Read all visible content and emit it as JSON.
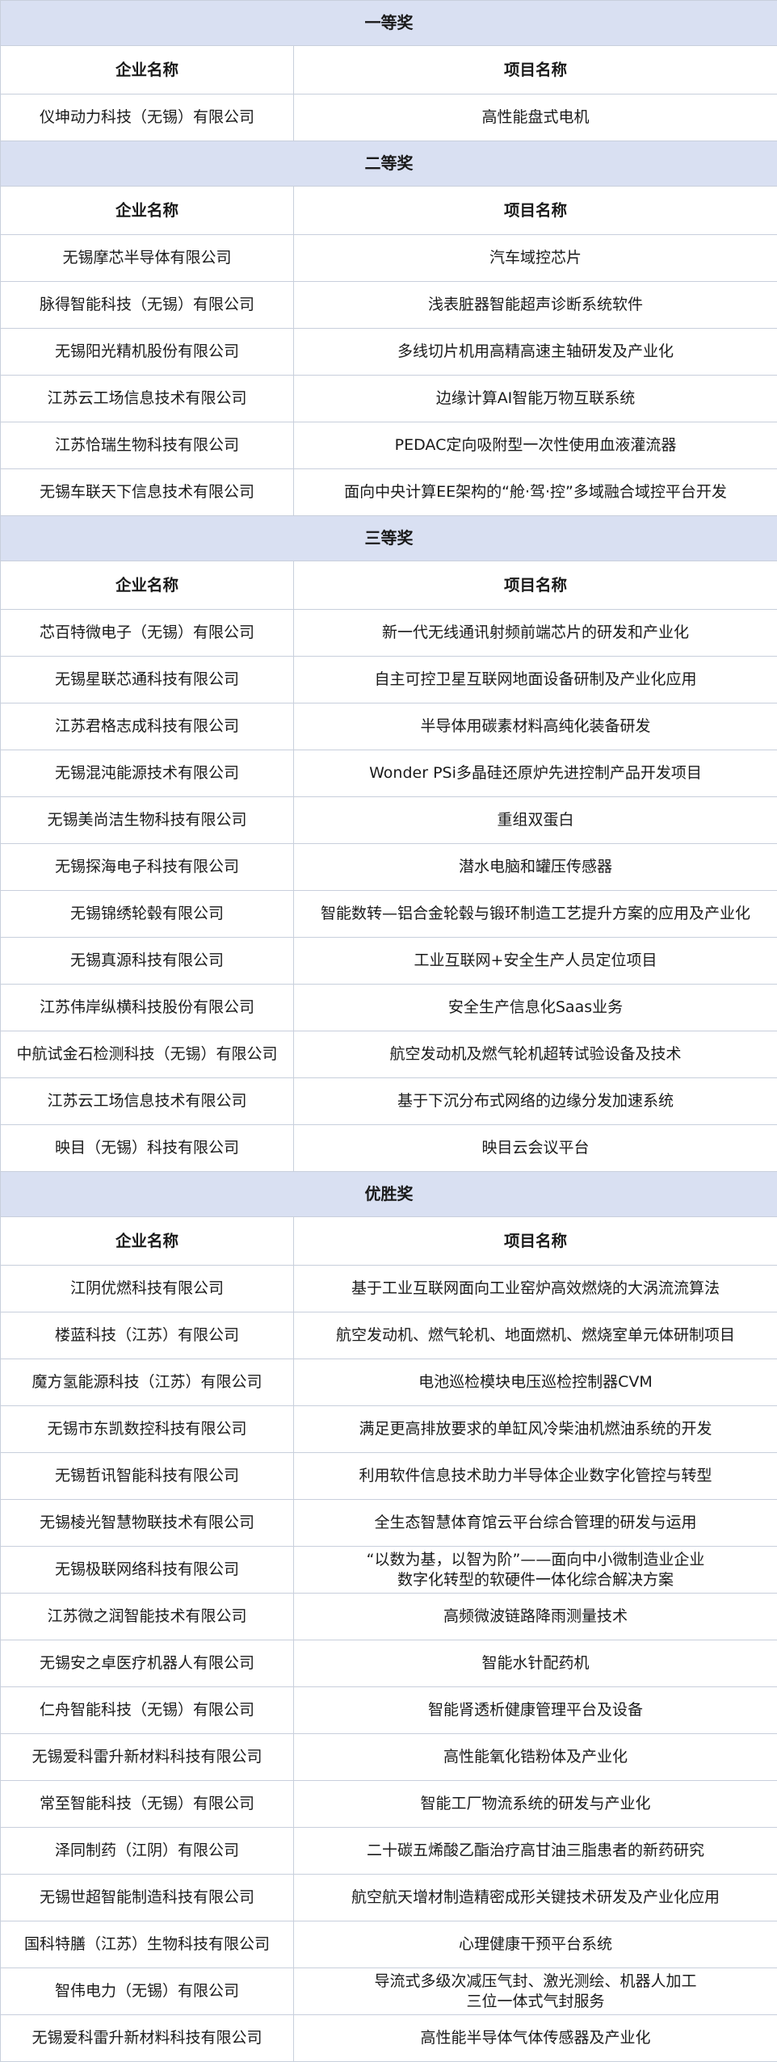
{
  "columns": {
    "company": "企业名称",
    "project": "项目名称"
  },
  "sections": [
    {
      "title": "一等奖",
      "rows": [
        {
          "company": "仪坤动力科技（无锡）有限公司",
          "project": "高性能盘式电机"
        }
      ]
    },
    {
      "title": "二等奖",
      "rows": [
        {
          "company": "无锡摩芯半导体有限公司",
          "project": "汽车域控芯片"
        },
        {
          "company": "脉得智能科技（无锡）有限公司",
          "project": "浅表脏器智能超声诊断系统软件"
        },
        {
          "company": "无锡阳光精机股份有限公司",
          "project": "多线切片机用高精高速主轴研发及产业化"
        },
        {
          "company": "江苏云工场信息技术有限公司",
          "project": "边缘计算AI智能万物互联系统"
        },
        {
          "company": "江苏恰瑞生物科技有限公司",
          "project": "PEDAC定向吸附型一次性使用血液灌流器"
        },
        {
          "company": "无锡车联天下信息技术有限公司",
          "project": "面向中央计算EE架构的“舱·驾·控”多域融合域控平台开发"
        }
      ]
    },
    {
      "title": "三等奖",
      "rows": [
        {
          "company": "芯百特微电子（无锡）有限公司",
          "project": "新一代无线通讯射频前端芯片的研发和产业化"
        },
        {
          "company": "无锡星联芯通科技有限公司",
          "project": "自主可控卫星互联网地面设备研制及产业化应用"
        },
        {
          "company": "江苏君格志成科技有限公司",
          "project": "半导体用碳素材料高纯化装备研发"
        },
        {
          "company": "无锡混沌能源技术有限公司",
          "project": "Wonder PSi多晶硅还原炉先进控制产品开发项目"
        },
        {
          "company": "无锡美尚洁生物科技有限公司",
          "project": "重组双蛋白"
        },
        {
          "company": "无锡探海电子科技有限公司",
          "project": "潜水电脑和罐压传感器"
        },
        {
          "company": "无锡锦绣轮毂有限公司",
          "project": "智能数转—铝合金轮毂与锻环制造工艺提升方案的应用及产业化"
        },
        {
          "company": "无锡真源科技有限公司",
          "project": "工业互联网+安全生产人员定位项目"
        },
        {
          "company": "江苏伟岸纵横科技股份有限公司",
          "project": "安全生产信息化Saas业务"
        },
        {
          "company": "中航试金石检测科技（无锡）有限公司",
          "project": "航空发动机及燃气轮机超转试验设备及技术"
        },
        {
          "company": "江苏云工场信息技术有限公司",
          "project": "基于下沉分布式网络的边缘分发加速系统"
        },
        {
          "company": "映目（无锡）科技有限公司",
          "project": "映目云会议平台"
        }
      ]
    },
    {
      "title": "优胜奖",
      "rows": [
        {
          "company": "江阴优燃科技有限公司",
          "project": "基于工业互联网面向工业窑炉高效燃烧的大涡流流算法"
        },
        {
          "company": "楼蓝科技（江苏）有限公司",
          "project": "航空发动机、燃气轮机、地面燃机、燃烧室单元体研制项目"
        },
        {
          "company": "魔方氢能源科技（江苏）有限公司",
          "project": "电池巡检模块电压巡检控制器CVM"
        },
        {
          "company": "无锡市东凯数控科技有限公司",
          "project": "满足更高排放要求的单缸风冷柴油机燃油系统的开发"
        },
        {
          "company": "无锡哲讯智能科技有限公司",
          "project": "利用软件信息技术助力半导体企业数字化管控与转型"
        },
        {
          "company": "无锡棱光智慧物联技术有限公司",
          "project": "全生态智慧体育馆云平台综合管理的研发与运用"
        },
        {
          "company": "无锡极联网络科技有限公司",
          "project": "“以数为基，以智为阶”——面向中小微制造业企业\n数字化转型的软硬件一体化综合解决方案"
        },
        {
          "company": "江苏微之润智能技术有限公司",
          "project": "高频微波链路降雨测量技术"
        },
        {
          "company": "无锡安之卓医疗机器人有限公司",
          "project": "智能水针配药机"
        },
        {
          "company": "仁舟智能科技（无锡）有限公司",
          "project": "智能肾透析健康管理平台及设备"
        },
        {
          "company": "无锡爱科雷升新材料科技有限公司",
          "project": "高性能氧化锆粉体及产业化"
        },
        {
          "company": "常至智能科技（无锡）有限公司",
          "project": "智能工厂物流系统的研发与产业化"
        },
        {
          "company": "泽同制药（江阴）有限公司",
          "project": "二十碳五烯酸乙酯治疗高甘油三脂患者的新药研究"
        },
        {
          "company": "无锡世超智能制造科技有限公司",
          "project": "航空航天增材制造精密成形关键技术研发及产业化应用"
        },
        {
          "company": "国科特膳（江苏）生物科技有限公司",
          "project": "心理健康干预平台系统"
        },
        {
          "company": "智伟电力（无锡）有限公司",
          "project": "导流式多级次减压气封、激光测绘、机器人加工\n三位一体式气封服务"
        },
        {
          "company": "无锡爱科雷升新材料科技有限公司",
          "project": "高性能半导体气体传感器及产业化"
        }
      ]
    }
  ]
}
